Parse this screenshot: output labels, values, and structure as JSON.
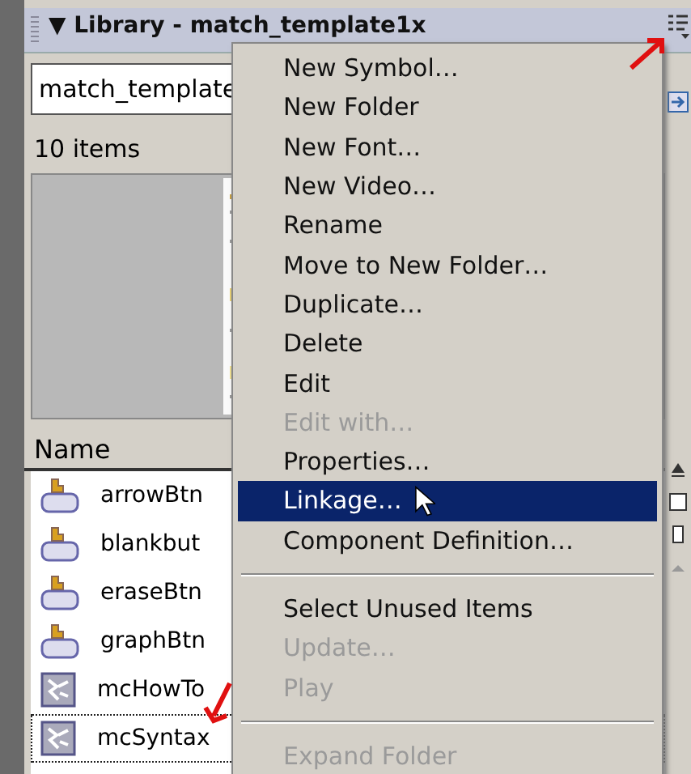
{
  "panel": {
    "title": "▼ Library - match_template1x",
    "document": "match_template",
    "count": "10 items",
    "column": "Name",
    "items": [
      {
        "name": "arrowBtn",
        "kind": "button",
        "selected": false
      },
      {
        "name": "blankbut",
        "kind": "button",
        "selected": false
      },
      {
        "name": "eraseBtn",
        "kind": "button",
        "selected": false
      },
      {
        "name": "graphBtn",
        "kind": "button",
        "selected": false
      },
      {
        "name": "mcHowTo",
        "kind": "movie-clip",
        "selected": false
      },
      {
        "name": "mcSyntax",
        "kind": "movie-clip",
        "selected": true
      }
    ]
  },
  "menu": [
    {
      "kind": "item",
      "label": "New Symbol…",
      "disabled": false,
      "selected": false
    },
    {
      "kind": "item",
      "label": "New Folder",
      "disabled": false,
      "selected": false
    },
    {
      "kind": "item",
      "label": "New Font…",
      "disabled": false,
      "selected": false
    },
    {
      "kind": "item",
      "label": "New Video…",
      "disabled": false,
      "selected": false
    },
    {
      "kind": "item",
      "label": "Rename",
      "disabled": false,
      "selected": false
    },
    {
      "kind": "item",
      "label": "Move to New Folder…",
      "disabled": false,
      "selected": false
    },
    {
      "kind": "item",
      "label": "Duplicate…",
      "disabled": false,
      "selected": false
    },
    {
      "kind": "item",
      "label": "Delete",
      "disabled": false,
      "selected": false
    },
    {
      "kind": "item",
      "label": "Edit",
      "disabled": false,
      "selected": false
    },
    {
      "kind": "item",
      "label": "Edit with…",
      "disabled": true,
      "selected": false
    },
    {
      "kind": "item",
      "label": "Properties…",
      "disabled": false,
      "selected": false
    },
    {
      "kind": "item",
      "label": "Linkage…",
      "disabled": false,
      "selected": true
    },
    {
      "kind": "item",
      "label": "Component Definition…",
      "disabled": false,
      "selected": false
    },
    {
      "kind": "separator"
    },
    {
      "kind": "item",
      "label": "Select Unused Items",
      "disabled": false,
      "selected": false
    },
    {
      "kind": "item",
      "label": "Update…",
      "disabled": true,
      "selected": false
    },
    {
      "kind": "item",
      "label": "Play",
      "disabled": true,
      "selected": false
    },
    {
      "kind": "separator"
    },
    {
      "kind": "item",
      "label": "Expand Folder",
      "disabled": true,
      "selected": false
    }
  ]
}
